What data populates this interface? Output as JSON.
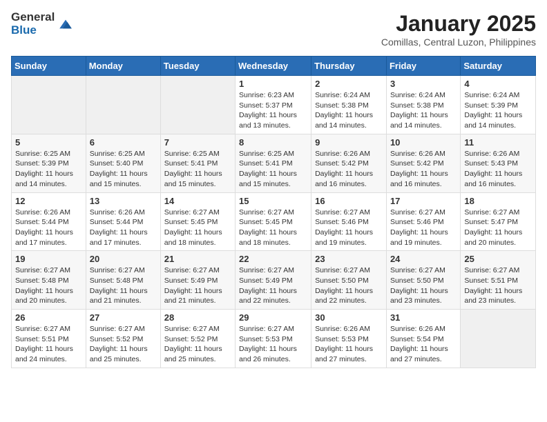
{
  "header": {
    "logo_general": "General",
    "logo_blue": "Blue",
    "month_title": "January 2025",
    "location": "Comillas, Central Luzon, Philippines"
  },
  "days_of_week": [
    "Sunday",
    "Monday",
    "Tuesday",
    "Wednesday",
    "Thursday",
    "Friday",
    "Saturday"
  ],
  "weeks": [
    [
      {
        "day": "",
        "info": ""
      },
      {
        "day": "",
        "info": ""
      },
      {
        "day": "",
        "info": ""
      },
      {
        "day": "1",
        "info": "Sunrise: 6:23 AM\nSunset: 5:37 PM\nDaylight: 11 hours and 13 minutes."
      },
      {
        "day": "2",
        "info": "Sunrise: 6:24 AM\nSunset: 5:38 PM\nDaylight: 11 hours and 14 minutes."
      },
      {
        "day": "3",
        "info": "Sunrise: 6:24 AM\nSunset: 5:38 PM\nDaylight: 11 hours and 14 minutes."
      },
      {
        "day": "4",
        "info": "Sunrise: 6:24 AM\nSunset: 5:39 PM\nDaylight: 11 hours and 14 minutes."
      }
    ],
    [
      {
        "day": "5",
        "info": "Sunrise: 6:25 AM\nSunset: 5:39 PM\nDaylight: 11 hours and 14 minutes."
      },
      {
        "day": "6",
        "info": "Sunrise: 6:25 AM\nSunset: 5:40 PM\nDaylight: 11 hours and 15 minutes."
      },
      {
        "day": "7",
        "info": "Sunrise: 6:25 AM\nSunset: 5:41 PM\nDaylight: 11 hours and 15 minutes."
      },
      {
        "day": "8",
        "info": "Sunrise: 6:25 AM\nSunset: 5:41 PM\nDaylight: 11 hours and 15 minutes."
      },
      {
        "day": "9",
        "info": "Sunrise: 6:26 AM\nSunset: 5:42 PM\nDaylight: 11 hours and 16 minutes."
      },
      {
        "day": "10",
        "info": "Sunrise: 6:26 AM\nSunset: 5:42 PM\nDaylight: 11 hours and 16 minutes."
      },
      {
        "day": "11",
        "info": "Sunrise: 6:26 AM\nSunset: 5:43 PM\nDaylight: 11 hours and 16 minutes."
      }
    ],
    [
      {
        "day": "12",
        "info": "Sunrise: 6:26 AM\nSunset: 5:44 PM\nDaylight: 11 hours and 17 minutes."
      },
      {
        "day": "13",
        "info": "Sunrise: 6:26 AM\nSunset: 5:44 PM\nDaylight: 11 hours and 17 minutes."
      },
      {
        "day": "14",
        "info": "Sunrise: 6:27 AM\nSunset: 5:45 PM\nDaylight: 11 hours and 18 minutes."
      },
      {
        "day": "15",
        "info": "Sunrise: 6:27 AM\nSunset: 5:45 PM\nDaylight: 11 hours and 18 minutes."
      },
      {
        "day": "16",
        "info": "Sunrise: 6:27 AM\nSunset: 5:46 PM\nDaylight: 11 hours and 19 minutes."
      },
      {
        "day": "17",
        "info": "Sunrise: 6:27 AM\nSunset: 5:46 PM\nDaylight: 11 hours and 19 minutes."
      },
      {
        "day": "18",
        "info": "Sunrise: 6:27 AM\nSunset: 5:47 PM\nDaylight: 11 hours and 20 minutes."
      }
    ],
    [
      {
        "day": "19",
        "info": "Sunrise: 6:27 AM\nSunset: 5:48 PM\nDaylight: 11 hours and 20 minutes."
      },
      {
        "day": "20",
        "info": "Sunrise: 6:27 AM\nSunset: 5:48 PM\nDaylight: 11 hours and 21 minutes."
      },
      {
        "day": "21",
        "info": "Sunrise: 6:27 AM\nSunset: 5:49 PM\nDaylight: 11 hours and 21 minutes."
      },
      {
        "day": "22",
        "info": "Sunrise: 6:27 AM\nSunset: 5:49 PM\nDaylight: 11 hours and 22 minutes."
      },
      {
        "day": "23",
        "info": "Sunrise: 6:27 AM\nSunset: 5:50 PM\nDaylight: 11 hours and 22 minutes."
      },
      {
        "day": "24",
        "info": "Sunrise: 6:27 AM\nSunset: 5:50 PM\nDaylight: 11 hours and 23 minutes."
      },
      {
        "day": "25",
        "info": "Sunrise: 6:27 AM\nSunset: 5:51 PM\nDaylight: 11 hours and 23 minutes."
      }
    ],
    [
      {
        "day": "26",
        "info": "Sunrise: 6:27 AM\nSunset: 5:51 PM\nDaylight: 11 hours and 24 minutes."
      },
      {
        "day": "27",
        "info": "Sunrise: 6:27 AM\nSunset: 5:52 PM\nDaylight: 11 hours and 25 minutes."
      },
      {
        "day": "28",
        "info": "Sunrise: 6:27 AM\nSunset: 5:52 PM\nDaylight: 11 hours and 25 minutes."
      },
      {
        "day": "29",
        "info": "Sunrise: 6:27 AM\nSunset: 5:53 PM\nDaylight: 11 hours and 26 minutes."
      },
      {
        "day": "30",
        "info": "Sunrise: 6:26 AM\nSunset: 5:53 PM\nDaylight: 11 hours and 27 minutes."
      },
      {
        "day": "31",
        "info": "Sunrise: 6:26 AM\nSunset: 5:54 PM\nDaylight: 11 hours and 27 minutes."
      },
      {
        "day": "",
        "info": ""
      }
    ]
  ]
}
